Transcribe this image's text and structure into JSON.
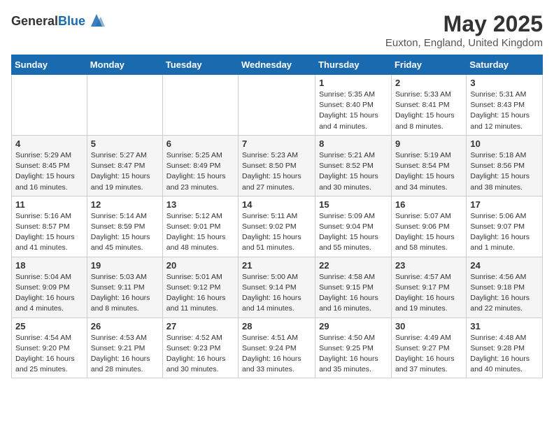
{
  "header": {
    "logo_general": "General",
    "logo_blue": "Blue",
    "month_title": "May 2025",
    "location": "Euxton, England, United Kingdom"
  },
  "days_of_week": [
    "Sunday",
    "Monday",
    "Tuesday",
    "Wednesday",
    "Thursday",
    "Friday",
    "Saturday"
  ],
  "weeks": [
    [
      {
        "day": "",
        "info": ""
      },
      {
        "day": "",
        "info": ""
      },
      {
        "day": "",
        "info": ""
      },
      {
        "day": "",
        "info": ""
      },
      {
        "day": "1",
        "info": "Sunrise: 5:35 AM\nSunset: 8:40 PM\nDaylight: 15 hours\nand 4 minutes."
      },
      {
        "day": "2",
        "info": "Sunrise: 5:33 AM\nSunset: 8:41 PM\nDaylight: 15 hours\nand 8 minutes."
      },
      {
        "day": "3",
        "info": "Sunrise: 5:31 AM\nSunset: 8:43 PM\nDaylight: 15 hours\nand 12 minutes."
      }
    ],
    [
      {
        "day": "4",
        "info": "Sunrise: 5:29 AM\nSunset: 8:45 PM\nDaylight: 15 hours\nand 16 minutes."
      },
      {
        "day": "5",
        "info": "Sunrise: 5:27 AM\nSunset: 8:47 PM\nDaylight: 15 hours\nand 19 minutes."
      },
      {
        "day": "6",
        "info": "Sunrise: 5:25 AM\nSunset: 8:49 PM\nDaylight: 15 hours\nand 23 minutes."
      },
      {
        "day": "7",
        "info": "Sunrise: 5:23 AM\nSunset: 8:50 PM\nDaylight: 15 hours\nand 27 minutes."
      },
      {
        "day": "8",
        "info": "Sunrise: 5:21 AM\nSunset: 8:52 PM\nDaylight: 15 hours\nand 30 minutes."
      },
      {
        "day": "9",
        "info": "Sunrise: 5:19 AM\nSunset: 8:54 PM\nDaylight: 15 hours\nand 34 minutes."
      },
      {
        "day": "10",
        "info": "Sunrise: 5:18 AM\nSunset: 8:56 PM\nDaylight: 15 hours\nand 38 minutes."
      }
    ],
    [
      {
        "day": "11",
        "info": "Sunrise: 5:16 AM\nSunset: 8:57 PM\nDaylight: 15 hours\nand 41 minutes."
      },
      {
        "day": "12",
        "info": "Sunrise: 5:14 AM\nSunset: 8:59 PM\nDaylight: 15 hours\nand 45 minutes."
      },
      {
        "day": "13",
        "info": "Sunrise: 5:12 AM\nSunset: 9:01 PM\nDaylight: 15 hours\nand 48 minutes."
      },
      {
        "day": "14",
        "info": "Sunrise: 5:11 AM\nSunset: 9:02 PM\nDaylight: 15 hours\nand 51 minutes."
      },
      {
        "day": "15",
        "info": "Sunrise: 5:09 AM\nSunset: 9:04 PM\nDaylight: 15 hours\nand 55 minutes."
      },
      {
        "day": "16",
        "info": "Sunrise: 5:07 AM\nSunset: 9:06 PM\nDaylight: 15 hours\nand 58 minutes."
      },
      {
        "day": "17",
        "info": "Sunrise: 5:06 AM\nSunset: 9:07 PM\nDaylight: 16 hours\nand 1 minute."
      }
    ],
    [
      {
        "day": "18",
        "info": "Sunrise: 5:04 AM\nSunset: 9:09 PM\nDaylight: 16 hours\nand 4 minutes."
      },
      {
        "day": "19",
        "info": "Sunrise: 5:03 AM\nSunset: 9:11 PM\nDaylight: 16 hours\nand 8 minutes."
      },
      {
        "day": "20",
        "info": "Sunrise: 5:01 AM\nSunset: 9:12 PM\nDaylight: 16 hours\nand 11 minutes."
      },
      {
        "day": "21",
        "info": "Sunrise: 5:00 AM\nSunset: 9:14 PM\nDaylight: 16 hours\nand 14 minutes."
      },
      {
        "day": "22",
        "info": "Sunrise: 4:58 AM\nSunset: 9:15 PM\nDaylight: 16 hours\nand 16 minutes."
      },
      {
        "day": "23",
        "info": "Sunrise: 4:57 AM\nSunset: 9:17 PM\nDaylight: 16 hours\nand 19 minutes."
      },
      {
        "day": "24",
        "info": "Sunrise: 4:56 AM\nSunset: 9:18 PM\nDaylight: 16 hours\nand 22 minutes."
      }
    ],
    [
      {
        "day": "25",
        "info": "Sunrise: 4:54 AM\nSunset: 9:20 PM\nDaylight: 16 hours\nand 25 minutes."
      },
      {
        "day": "26",
        "info": "Sunrise: 4:53 AM\nSunset: 9:21 PM\nDaylight: 16 hours\nand 28 minutes."
      },
      {
        "day": "27",
        "info": "Sunrise: 4:52 AM\nSunset: 9:23 PM\nDaylight: 16 hours\nand 30 minutes."
      },
      {
        "day": "28",
        "info": "Sunrise: 4:51 AM\nSunset: 9:24 PM\nDaylight: 16 hours\nand 33 minutes."
      },
      {
        "day": "29",
        "info": "Sunrise: 4:50 AM\nSunset: 9:25 PM\nDaylight: 16 hours\nand 35 minutes."
      },
      {
        "day": "30",
        "info": "Sunrise: 4:49 AM\nSunset: 9:27 PM\nDaylight: 16 hours\nand 37 minutes."
      },
      {
        "day": "31",
        "info": "Sunrise: 4:48 AM\nSunset: 9:28 PM\nDaylight: 16 hours\nand 40 minutes."
      }
    ]
  ],
  "row_classes": [
    "row-white",
    "row-gray",
    "row-white",
    "row-gray",
    "row-white"
  ]
}
